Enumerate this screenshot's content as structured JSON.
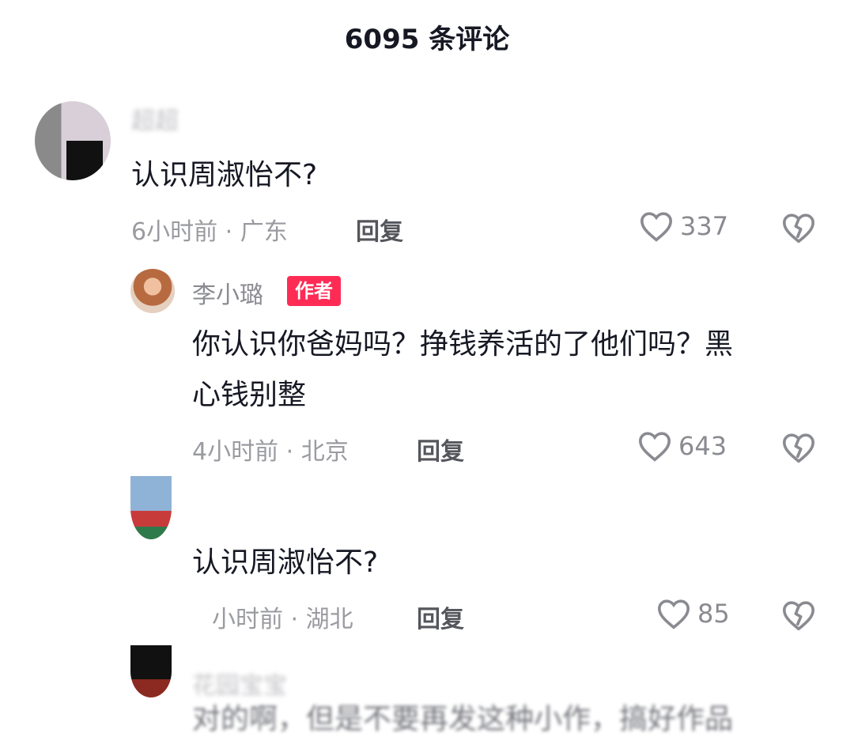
{
  "header": {
    "title": "6095 条评论"
  },
  "comments": [
    {
      "username": "超超",
      "text": "认识周淑怡不?",
      "meta": "6小时前 · 广东",
      "reply": "回复",
      "likes": "337"
    },
    {
      "username": "李小璐",
      "badge": "作者",
      "text_line1": "你认识你爸妈吗？挣钱养活的了他们吗？黑",
      "text_line2": "心钱别整",
      "meta": "4小时前 · 北京",
      "reply": "回复",
      "likes": "643"
    },
    {
      "username": "",
      "text": "认识周淑怡不?",
      "meta": "小时前 · 湖北",
      "reply": "回复",
      "likes": "85"
    },
    {
      "username": "花园宝宝",
      "text": "对的啊，但是不要再发这种小作，搞好作品"
    }
  ]
}
